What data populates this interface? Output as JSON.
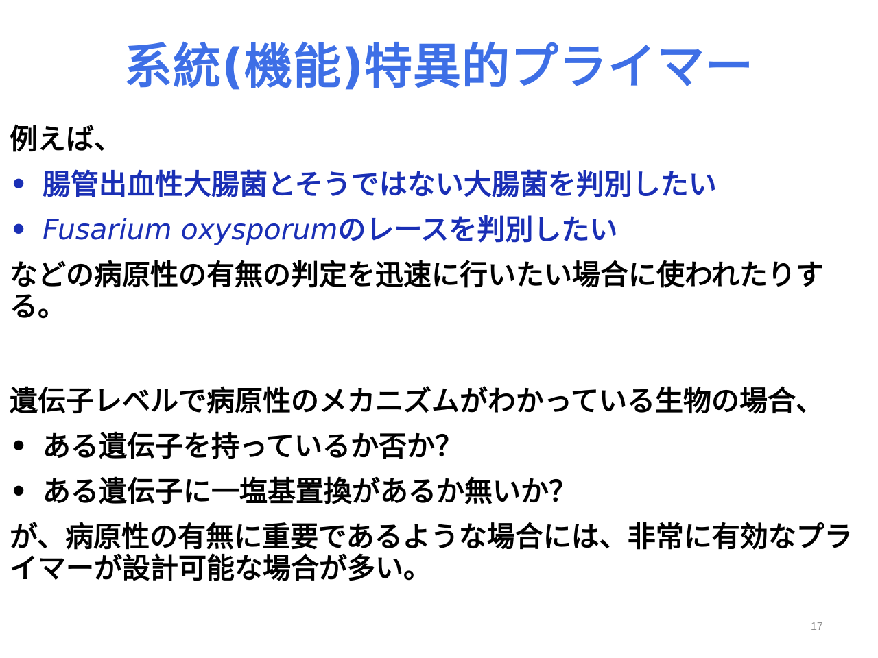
{
  "slide": {
    "title": "系統(機能)特異的プライマー",
    "intro": "例えば、",
    "bullets1": [
      {
        "text": "腸管出血性大腸菌とそうではない大腸菌を判別したい"
      },
      {
        "italic": "Fusarium oxysporum",
        "text": "のレースを判別したい"
      }
    ],
    "para1": "などの病原性の有無の判定を迅速に行いたい場合に使われたりする。",
    "para2": "遺伝子レベルで病原性のメカニズムがわかっている生物の場合、",
    "bullets2": [
      {
        "text": "ある遺伝子を持っているか否か？"
      },
      {
        "text": "ある遺伝子に一塩基置換があるか無いか？"
      }
    ],
    "para3": "が、病原性の有無に重要であるような場合には、非常に有効なプライマーが設計可能な場合が多い。",
    "bullet_symbol": "•",
    "page_number": "17"
  },
  "colors": {
    "title": "#3e6fe6",
    "bullet_blue": "#1a2fb5",
    "text": "#000000",
    "page_number": "#8c8c8c"
  }
}
